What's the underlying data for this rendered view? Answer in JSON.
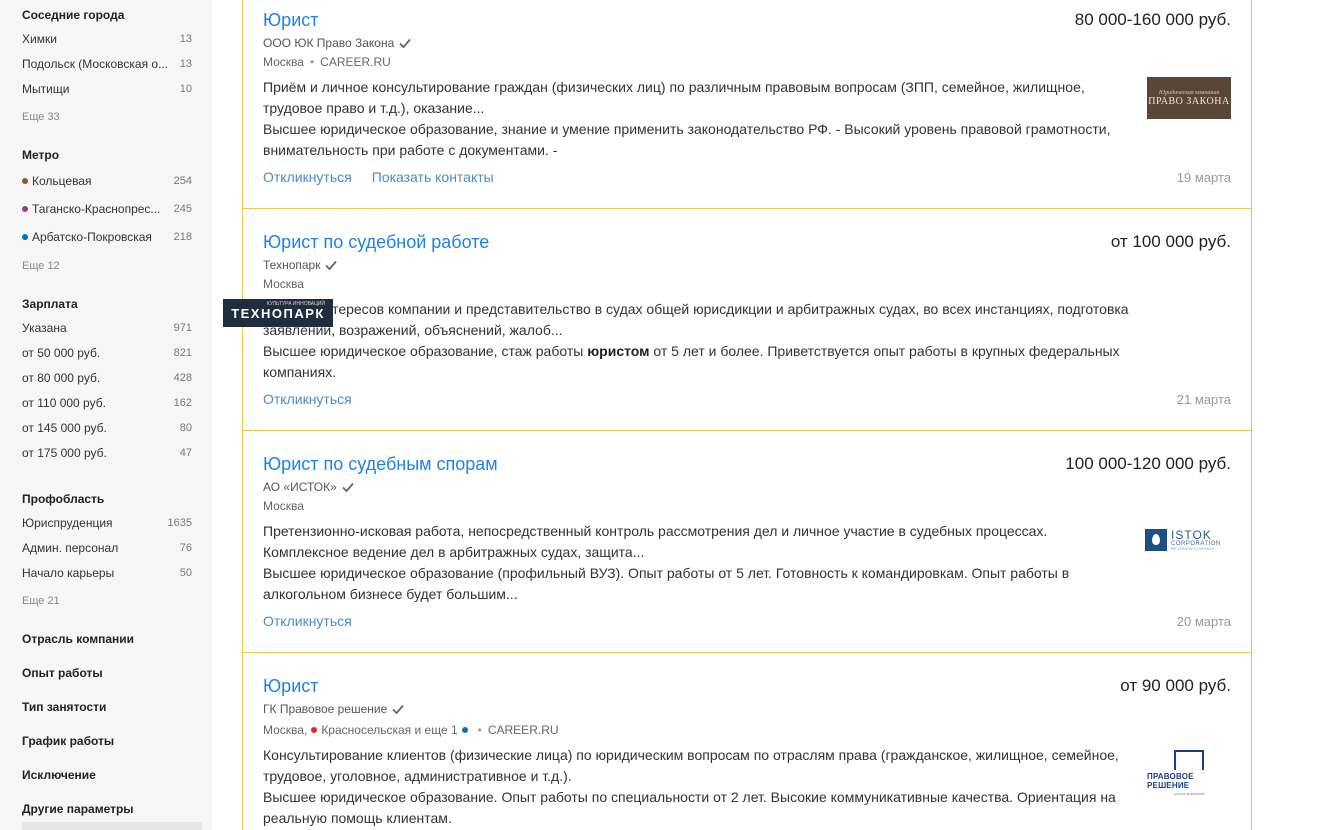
{
  "sidebar": {
    "neighbor_cities": {
      "title": "Соседние города",
      "items": [
        {
          "label": "Химки",
          "count": "13"
        },
        {
          "label": "Подольск (Московская о...",
          "count": "13"
        },
        {
          "label": "Мытищи",
          "count": "10"
        }
      ],
      "more": "Еще 33"
    },
    "metro": {
      "title": "Метро",
      "items": [
        {
          "label": "Кольцевая",
          "count": "254",
          "color": "#8d5b2d"
        },
        {
          "label": "Таганско-Краснопрес...",
          "count": "245",
          "color": "#943e90"
        },
        {
          "label": "Арбатско-Покровская",
          "count": "218",
          "color": "#0a6dc8"
        }
      ],
      "more": "Еще 12"
    },
    "salary": {
      "title": "Зарплата",
      "items": [
        {
          "label": "Указана",
          "count": "971"
        },
        {
          "label": "от 50 000 руб.",
          "count": "821"
        },
        {
          "label": "от 80 000 руб.",
          "count": "428"
        },
        {
          "label": "от 110 000 руб.",
          "count": "162"
        },
        {
          "label": "от 145 000 руб.",
          "count": "80"
        },
        {
          "label": "от 175 000 руб.",
          "count": "47"
        }
      ]
    },
    "profarea": {
      "title": "Профобласть",
      "items": [
        {
          "label": "Юриспруденция",
          "count": "1635"
        },
        {
          "label": "Админ. персонал",
          "count": "76"
        },
        {
          "label": "Начало карьеры",
          "count": "50"
        }
      ],
      "more": "Еще 21"
    },
    "collapsed": [
      "Отрасль компании",
      "Опыт работы",
      "Тип занятости",
      "График работы",
      "Исключение",
      "Другие параметры"
    ]
  },
  "vacancies": [
    {
      "title": "Юрист",
      "salary": "80 000-160 000 руб.",
      "company": "ООО ЮК Право Закона",
      "city": "Москва",
      "source": "CAREER.RU",
      "desc1": "Приём и личное консультирование граждан (физических лиц) по различным правовым вопросам (ЗПП, семейное, жилищное, трудовое право и т.д.), оказание...",
      "desc2": "Высшее юридическое образование, знание и умение применить законодательство РФ. - Высокий уровень правовой грамотности, внимательность при работе с документами. -",
      "action1": "Откликнуться",
      "action2": "Показать контакты",
      "date": "19 марта",
      "logo_small": "Юридическая компания",
      "logo_big": "ПРАВО ЗАКОНА"
    },
    {
      "title": "Юрист по судебной работе",
      "salary": "от 100 000 руб.",
      "company": "Технопарк",
      "city": "Москва",
      "desc1": "Защита интересов компании и представительство в судах общей юрисдикции и арбитражных судах, во всех инстанциях, подготовка заявлений, возражений, объяснений, жалоб...",
      "desc2_a": "Высшее юридическое образование, стаж работы ",
      "desc2_b": "юристом",
      "desc2_c": " от 5 лет и более. Приветствуется опыт работы в крупных федеральных компаниях.",
      "action1": "Откликнуться",
      "date": "21 марта",
      "logo_tiny": "КУЛЬТУРА ИННОВАЦИЙ",
      "logo_big": "ТЕХНОПАРК"
    },
    {
      "title": "Юрист по судебным спорам",
      "salary": "100 000-120 000 руб.",
      "company": "АО «ИСТОК»",
      "city": "Москва",
      "desc1": "Претензионно-исковая работа, непосредственный контроль рассмотрения дел и личное участие в судебных процессах. Комплексное ведение дел в арбитражных судах, защита...",
      "desc2": "Высшее юридическое образование (профильный ВУЗ). Опыт работы от 5 лет. Готовность к командировкам. Опыт работы в алкогольном бизнесе будет большим...",
      "action1": "Откликнуться",
      "date": "20 марта",
      "logo_t1": "ISTOK",
      "logo_t2": "CORPORATION",
      "logo_t3": "BEVERAGE COMPANY"
    },
    {
      "title": "Юрист",
      "salary": "от 90 000 руб.",
      "company": "ГК Правовое решение",
      "city": "Москва,",
      "metro": "Красносельская и еще 1",
      "source": "CAREER.RU",
      "desc1": "Консультирование клиентов (физические лица) по юридическим вопросам по отраслям права (гражданское, жилищное, семейное, трудовое, уголовное, административное и т.д.).",
      "desc2": "Высшее юридическое образование. Опыт работы по специальности от 2 лет. Высокие коммуникативные качества. Ориентация на реальную помощь клиентам.",
      "logo_name": "ПРАВОВОЕ РЕШЕНИЕ",
      "logo_sub": "группа компаний"
    }
  ],
  "colors": {
    "link": "#1d83e8",
    "action": "#4a8bc9",
    "card_border": "#f0c34a",
    "metro_red": "#e4262c",
    "metro_blue": "#0a6dc8"
  }
}
